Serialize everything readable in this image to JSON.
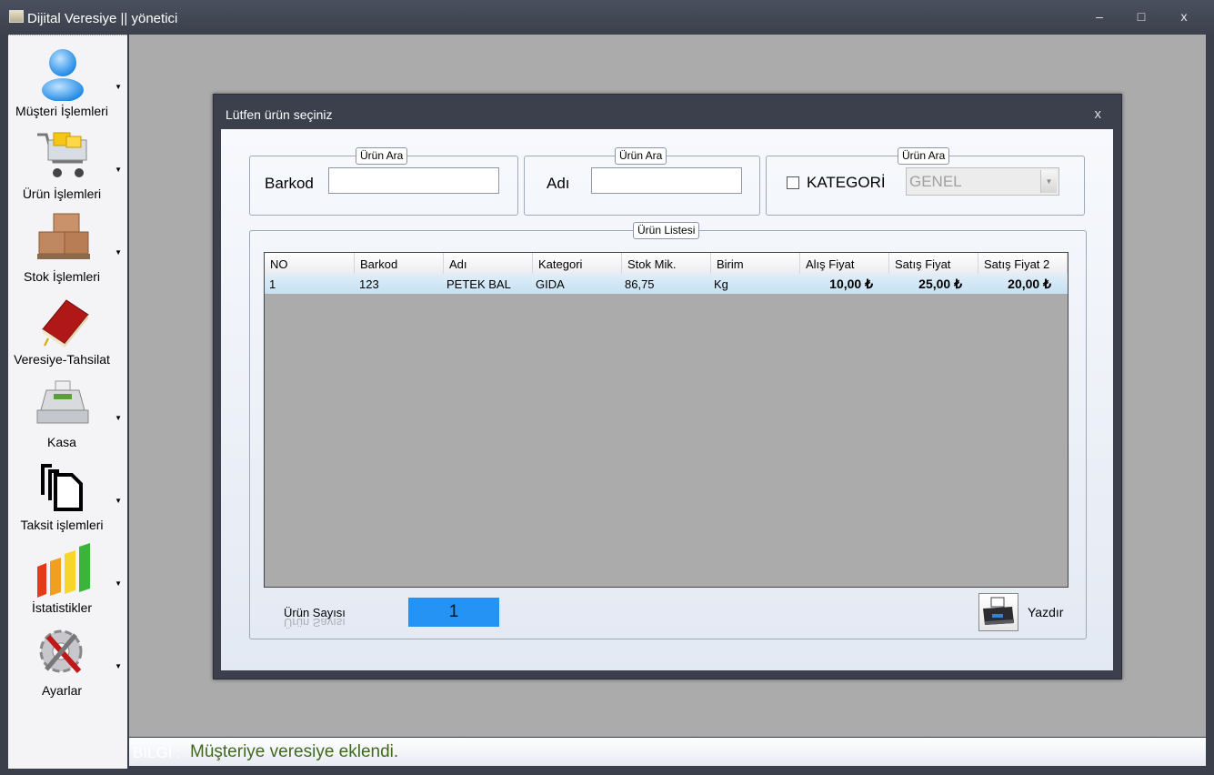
{
  "window": {
    "title": "Dijital Veresiye  ||  yönetici",
    "controls": {
      "minimize": "–",
      "maximize": "□",
      "close": "x"
    }
  },
  "sidebar": {
    "items": [
      {
        "label": "Müşteri İşlemleri",
        "icon": "user-icon"
      },
      {
        "label": "Ürün İşlemleri",
        "icon": "shopping-cart-icon"
      },
      {
        "label": "Stok İşlemleri",
        "icon": "boxes-icon"
      },
      {
        "label": "Veresiye-Tahsilat",
        "icon": "ledger-book-icon"
      },
      {
        "label": "Kasa",
        "icon": "cash-register-icon"
      },
      {
        "label": "Taksit işlemleri",
        "icon": "documents-icon"
      },
      {
        "label": "İstatistikler",
        "icon": "bar-chart-icon"
      },
      {
        "label": "Ayarlar",
        "icon": "settings-tools-icon"
      }
    ]
  },
  "status": {
    "label": "BİLGİ :",
    "message": "Müşteriye veresiye eklendi.",
    "message_color": "#3f6a1c"
  },
  "dialog": {
    "title": "Lütfen ürün seçiniz",
    "close": "x",
    "search_barkod": {
      "legend": "Ürün Ara",
      "label": "Barkod",
      "value": ""
    },
    "search_adi": {
      "legend": "Ürün Ara",
      "label": "Adı",
      "value": ""
    },
    "search_kategori": {
      "legend": "Ürün Ara",
      "label": "KATEGORİ",
      "checked": false,
      "selected": "GENEL"
    },
    "list": {
      "legend": "Ürün Listesi",
      "columns": [
        "NO",
        "Barkod",
        "Adı",
        "Kategori",
        "Stok Mik.",
        "Birim",
        "Alış Fiyat",
        "Satış Fiyat",
        "Satış Fiyat 2"
      ],
      "rows": [
        {
          "no": "1",
          "barkod": "123",
          "adi": "PETEK BAL",
          "kategori": "GIDA",
          "stok": "86,75",
          "birim": "Kg",
          "alis": "10,00 ₺",
          "satis": "25,00 ₺",
          "satis2": "20,00 ₺"
        }
      ],
      "selected_row_color": "#c6e1f2"
    },
    "count_label": "Ürün Sayısı",
    "count_value": "1",
    "count_color": "#2493f4",
    "print_label": "Yazdır"
  }
}
